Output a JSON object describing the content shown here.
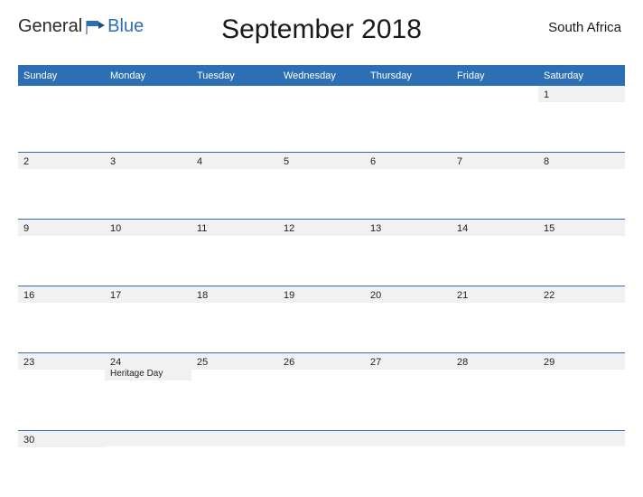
{
  "logo": {
    "part1": "General",
    "part2": "Blue"
  },
  "title": "September 2018",
  "region": "South Africa",
  "daynames": [
    "Sunday",
    "Monday",
    "Tuesday",
    "Wednesday",
    "Thursday",
    "Friday",
    "Saturday"
  ],
  "weeks": [
    [
      {
        "num": "",
        "event": ""
      },
      {
        "num": "",
        "event": ""
      },
      {
        "num": "",
        "event": ""
      },
      {
        "num": "",
        "event": ""
      },
      {
        "num": "",
        "event": ""
      },
      {
        "num": "",
        "event": ""
      },
      {
        "num": "1",
        "event": ""
      }
    ],
    [
      {
        "num": "2",
        "event": ""
      },
      {
        "num": "3",
        "event": ""
      },
      {
        "num": "4",
        "event": ""
      },
      {
        "num": "5",
        "event": ""
      },
      {
        "num": "6",
        "event": ""
      },
      {
        "num": "7",
        "event": ""
      },
      {
        "num": "8",
        "event": ""
      }
    ],
    [
      {
        "num": "9",
        "event": ""
      },
      {
        "num": "10",
        "event": ""
      },
      {
        "num": "11",
        "event": ""
      },
      {
        "num": "12",
        "event": ""
      },
      {
        "num": "13",
        "event": ""
      },
      {
        "num": "14",
        "event": ""
      },
      {
        "num": "15",
        "event": ""
      }
    ],
    [
      {
        "num": "16",
        "event": ""
      },
      {
        "num": "17",
        "event": ""
      },
      {
        "num": "18",
        "event": ""
      },
      {
        "num": "19",
        "event": ""
      },
      {
        "num": "20",
        "event": ""
      },
      {
        "num": "21",
        "event": ""
      },
      {
        "num": "22",
        "event": ""
      }
    ],
    [
      {
        "num": "23",
        "event": ""
      },
      {
        "num": "24",
        "event": "Heritage Day"
      },
      {
        "num": "25",
        "event": ""
      },
      {
        "num": "26",
        "event": ""
      },
      {
        "num": "27",
        "event": ""
      },
      {
        "num": "28",
        "event": ""
      },
      {
        "num": "29",
        "event": ""
      }
    ],
    [
      {
        "num": "30",
        "event": ""
      },
      {
        "num": "",
        "event": ""
      },
      {
        "num": "",
        "event": ""
      },
      {
        "num": "",
        "event": ""
      },
      {
        "num": "",
        "event": ""
      },
      {
        "num": "",
        "event": ""
      },
      {
        "num": "",
        "event": ""
      }
    ]
  ]
}
